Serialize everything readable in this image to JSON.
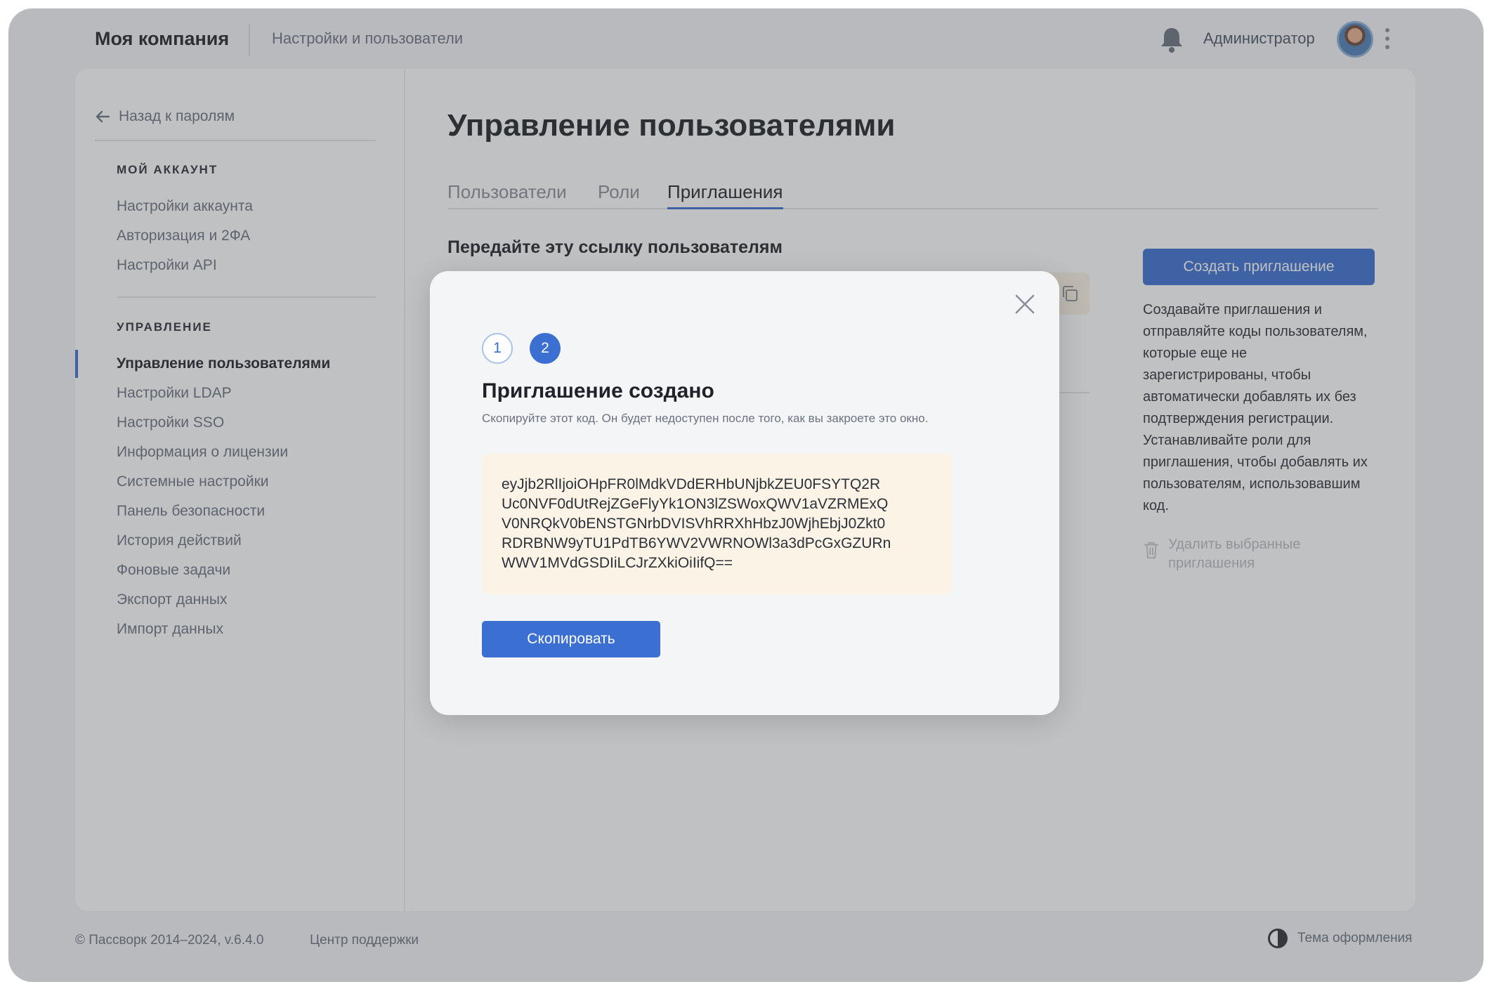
{
  "header": {
    "brand": "Моя компания",
    "breadcrumb": "Настройки и пользователи",
    "admin_name": "Администратор"
  },
  "sidebar": {
    "back_label": "Назад к паролям",
    "section_account": "МОЙ АККАУНТ",
    "account_items": [
      "Настройки аккаунта",
      "Авторизация и 2ФА",
      "Настройки API"
    ],
    "section_management": "УПРАВЛЕНИЕ",
    "management_items": [
      "Управление пользователями",
      "Настройки LDAP",
      "Настройки SSO",
      "Информация о лицензии",
      "Системные настройки",
      "Панель безопасности",
      "История действий",
      "Фоновые задачи",
      "Экспорт данных",
      "Импорт данных"
    ],
    "active_item": "Управление пользователями"
  },
  "main": {
    "title": "Управление пользователями",
    "tabs": [
      "Пользователи",
      "Роли",
      "Приглашения"
    ],
    "active_tab": "Приглашения",
    "link_title": "Передайте эту ссылку пользователям",
    "create_button": "Создать приглашение",
    "info_text": "Создавайте приглашения и отправляйте коды пользователям, которые еще не зарегистрированы, чтобы автоматически добавлять их без подтверждения регистрации. Устанавливайте роли для приглашения, чтобы добавлять их пользователям, использовавшим код.",
    "delete_selected": "Удалить выбранные приглашения"
  },
  "modal": {
    "steps": [
      "1",
      "2"
    ],
    "active_step": "2",
    "title": "Приглашение создано",
    "subtitle": "Скопируйте этот код. Он будет недоступен после того, как вы закроете это окно.",
    "code_lines": [
      "eyJjb2RlIjoiOHpFR0lMdkVDdERHbUNjbkZEU0FSYTQ2R",
      "Uc0NVF0dUtRejZGeFlyYk1ON3lZSWoxQWV1aVZRMExQ",
      "V0NRQkV0bENSTGNrbDVISVhRRXhHbzJ0WjhEbjJ0Zkt0",
      "RDRBNW9yTU1PdTB6YWV2VWRNOWl3a3dPcGxGZURn",
      "WWV1MVdGSDIiLCJrZXkiOiIifQ=="
    ],
    "copy_button": "Скопировать"
  },
  "footer": {
    "copyright": "© Пассворк 2014–2024, v.6.4.0",
    "support": "Центр поддержки",
    "theme": "Тема оформления"
  },
  "colors": {
    "accent": "#3b6fd1",
    "code_background": "#fbf3e6"
  },
  "icons": [
    "arrow-left-icon",
    "bell-icon",
    "kebab-menu-icon",
    "copy-icon",
    "trash-icon",
    "close-icon",
    "theme-contrast-icon"
  ]
}
